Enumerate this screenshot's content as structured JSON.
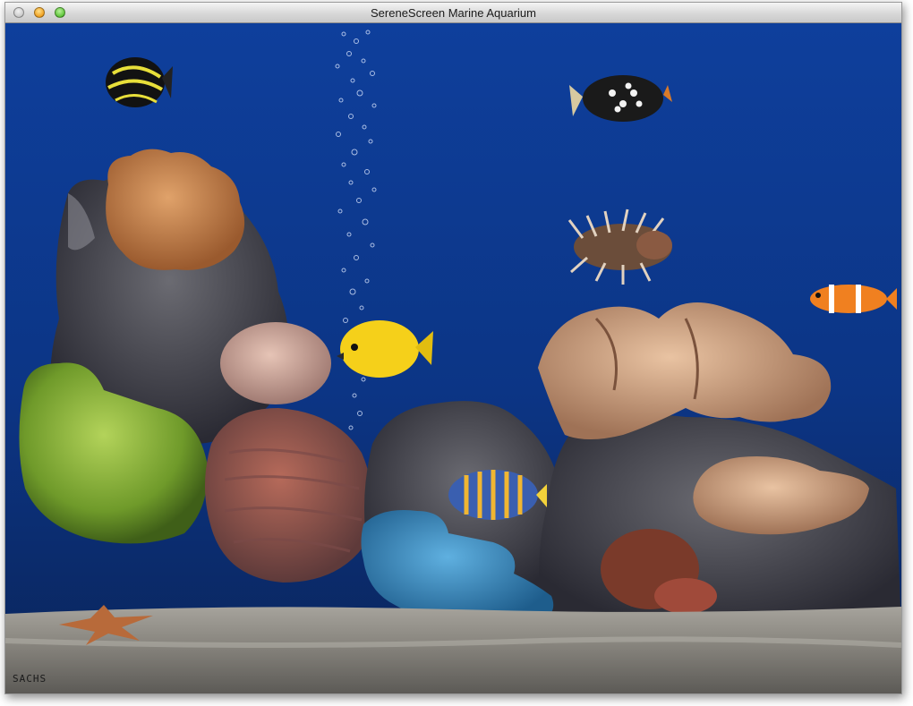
{
  "window": {
    "title": "SereneScreen Marine Aquarium"
  },
  "scene": {
    "watermark": "SACHS",
    "colors": {
      "water_top": "#0e3f9c",
      "water_bottom": "#0b2a66",
      "sand": "#8f8f8f"
    },
    "fish": [
      {
        "name": "angelfish",
        "icon": "angelfish"
      },
      {
        "name": "clown-triggerfish",
        "icon": "triggerfish"
      },
      {
        "name": "lionfish",
        "icon": "lionfish"
      },
      {
        "name": "clownfish",
        "icon": "clownfish"
      },
      {
        "name": "yellow-tang",
        "icon": "tang"
      },
      {
        "name": "striped-fish",
        "icon": "striped-fish"
      }
    ]
  }
}
